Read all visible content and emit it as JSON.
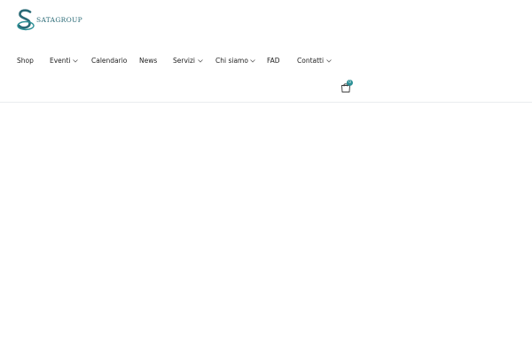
{
  "brand": {
    "logo_text": "SATAGROUP",
    "primary_color": "#2a6a76",
    "accent_color": "#2a8f95"
  },
  "nav": {
    "items": [
      {
        "label": "Shop",
        "has_submenu": false
      },
      {
        "label": "Eventi",
        "has_submenu": true
      },
      {
        "label": "Calendario",
        "has_submenu": false
      },
      {
        "label": "News",
        "has_submenu": false
      },
      {
        "label": "Servizi",
        "has_submenu": true
      },
      {
        "label": "Chi siamo",
        "has_submenu": true
      },
      {
        "label": "FAD",
        "has_submenu": false
      },
      {
        "label": "Contatti",
        "has_submenu": true
      }
    ]
  },
  "cart": {
    "icon": "shopping-bag-icon",
    "count": "0"
  }
}
